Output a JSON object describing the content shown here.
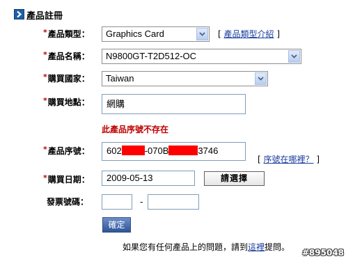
{
  "section": {
    "title": "產品註冊"
  },
  "required_mark": "*",
  "fields": {
    "product_type": {
      "label": "產品類型：",
      "value": "Graphics Card",
      "help_link": "產品類型介紹",
      "bracket_open": "[",
      "bracket_close": "]"
    },
    "product_name": {
      "label": "產品名稱：",
      "value": "N9800GT-T2D512-OC"
    },
    "purchase_country": {
      "label": "購買國家：",
      "value": "Taiwan"
    },
    "purchase_location": {
      "label": "購買地點：",
      "value": "網購"
    },
    "serial_error": "此產品序號不存在",
    "serial_number": {
      "label": "產品序號：",
      "value_part1": "602",
      "value_part2": "-070B",
      "value_part3": "3746",
      "help_link": "序號在哪裡？",
      "bracket_open": "[",
      "bracket_close": "]"
    },
    "purchase_date": {
      "label": "購買日期：",
      "value": "2009-05-13",
      "choose_button": "請選擇"
    },
    "invoice_number": {
      "label": "發票號碼：",
      "separator": "-"
    }
  },
  "submit_button": "確定",
  "footer": {
    "prefix": "如果您有任何產品上的問題，請到",
    "link": "這裡",
    "suffix": "提問。"
  },
  "watermark": "#895048",
  "colors": {
    "accent": "#1f5fa8",
    "error": "#c00000",
    "link": "#1a3e9e",
    "redaction": "#ff0000"
  },
  "icons": {
    "section": "chevron-right-icon",
    "dropdown": "chevron-down-icon"
  }
}
